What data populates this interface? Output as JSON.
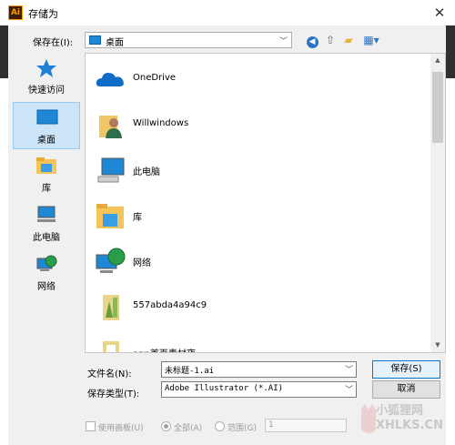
{
  "window": {
    "title": "存储为",
    "app_icon": "Ai"
  },
  "toolbar": {
    "save_in_label": "保存在(I):",
    "location_value": "桌面"
  },
  "places": [
    {
      "label": "快速访问",
      "icon": "quick-access-star-icon"
    },
    {
      "label": "桌面",
      "icon": "desktop-icon",
      "selected": true
    },
    {
      "label": "库",
      "icon": "libraries-icon"
    },
    {
      "label": "此电脑",
      "icon": "this-pc-icon"
    },
    {
      "label": "网络",
      "icon": "network-icon"
    }
  ],
  "files": [
    {
      "name": "OneDrive",
      "icon": "onedrive-cloud-icon"
    },
    {
      "name": "Willwindows",
      "icon": "user-folder-icon"
    },
    {
      "name": "此电脑",
      "icon": "this-pc-icon"
    },
    {
      "name": "库",
      "icon": "libraries-icon"
    },
    {
      "name": "网络",
      "icon": "network-icon"
    },
    {
      "name": "557abda4a94c9",
      "icon": "folder-icon"
    },
    {
      "name": "app首页素材夜",
      "icon": "folder-icon"
    }
  ],
  "form": {
    "filename_label": "文件名(N):",
    "filename_value": "未标题-1.ai",
    "filetype_label": "保存类型(T):",
    "filetype_value": "Adobe Illustrator (*.AI)"
  },
  "buttons": {
    "save": "保存(S)",
    "cancel": "取消"
  },
  "options": {
    "use_artboards": "使用画板(U)",
    "all": "全部(A)",
    "range": "范围(G)",
    "range_value": "1"
  },
  "watermark": {
    "line1": "小狐狸网",
    "line2": "XHLKS.CN"
  }
}
